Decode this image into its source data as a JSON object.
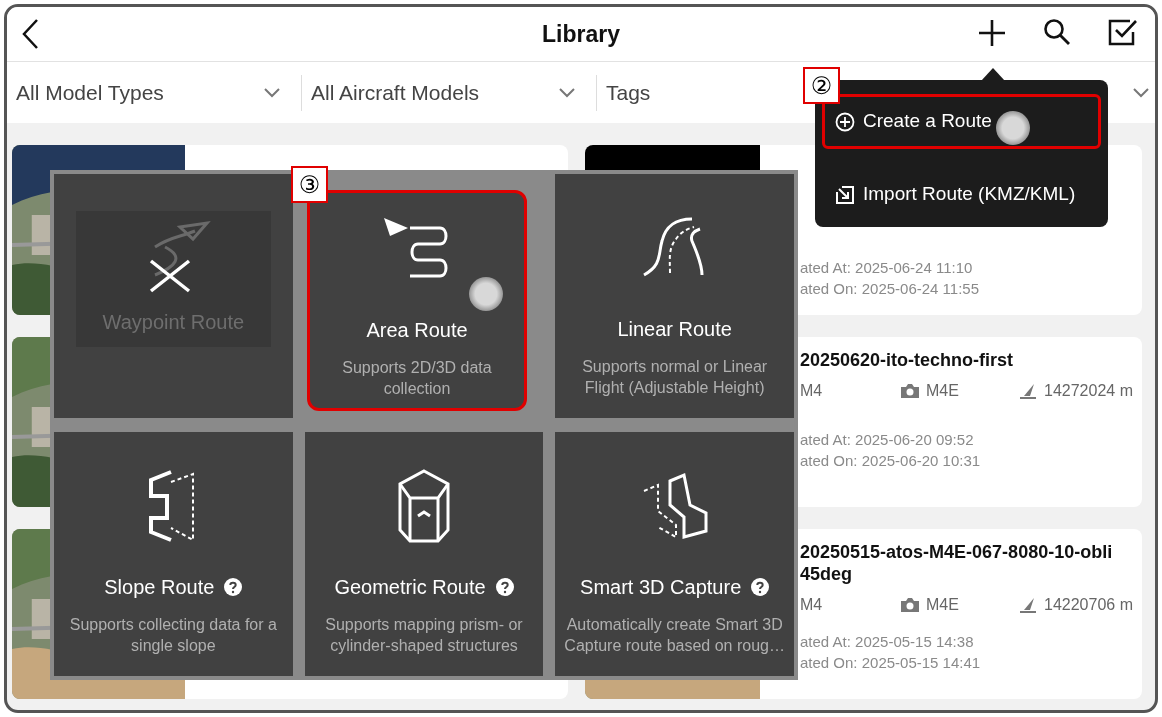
{
  "header": {
    "title": "Library"
  },
  "filters": [
    {
      "label": "All Model Types"
    },
    {
      "label": "All Aircraft Models"
    },
    {
      "label": "Tags"
    }
  ],
  "right_cards": [
    {
      "kind": "blank",
      "created": "ated At: 2025-06-24 11:10",
      "updated": "ated On: 2025-06-24 11:55"
    },
    {
      "title": "20250620-ito-techno-first",
      "aircraft": "M4",
      "camera": "M4E",
      "distance": "14272024 m",
      "created": "ated At: 2025-06-20 09:52",
      "updated": "ated On: 2025-06-20 10:31"
    },
    {
      "kind": "picture",
      "title": "20250515-atos-M4E-067-8080-10-obli 45deg",
      "aircraft": "M4",
      "camera": "M4E",
      "distance": "14220706 m",
      "created": "ated At: 2025-05-15 14:38",
      "updated": "ated On: 2025-05-15 14:41"
    }
  ],
  "create_menu": {
    "items": [
      {
        "kind": "create",
        "label": "Create a Route",
        "annotated": true
      },
      {
        "kind": "import",
        "label": "Import Route (KMZ/KML)",
        "annotated": false
      }
    ]
  },
  "route_types": [
    {
      "kind": "waypoint",
      "title": "Waypoint Route",
      "disabled": true,
      "help": false,
      "annotated": false
    },
    {
      "kind": "area",
      "title": "Area Route",
      "description": "Supports 2D/3D data collection",
      "disabled": false,
      "help": false,
      "annotated": true
    },
    {
      "kind": "linear",
      "title": "Linear Route",
      "description": "Supports normal or Linear Flight (Adjustable Height)",
      "disabled": false,
      "help": false,
      "annotated": false
    },
    {
      "kind": "slope",
      "title": "Slope Route",
      "description": "Supports collecting data for a single slope",
      "disabled": false,
      "help": true,
      "annotated": false
    },
    {
      "kind": "geometric",
      "title": "Geometric Route",
      "description": "Supports mapping prism- or cylinder-shaped structures",
      "disabled": false,
      "help": true,
      "annotated": false
    },
    {
      "kind": "smart3d",
      "title": "Smart 3D Capture",
      "description": "Automatically create Smart 3D Capture route based on roug…",
      "disabled": false,
      "help": true,
      "annotated": false
    }
  ],
  "markers": [
    {
      "label": "②"
    },
    {
      "label": "③"
    }
  ]
}
